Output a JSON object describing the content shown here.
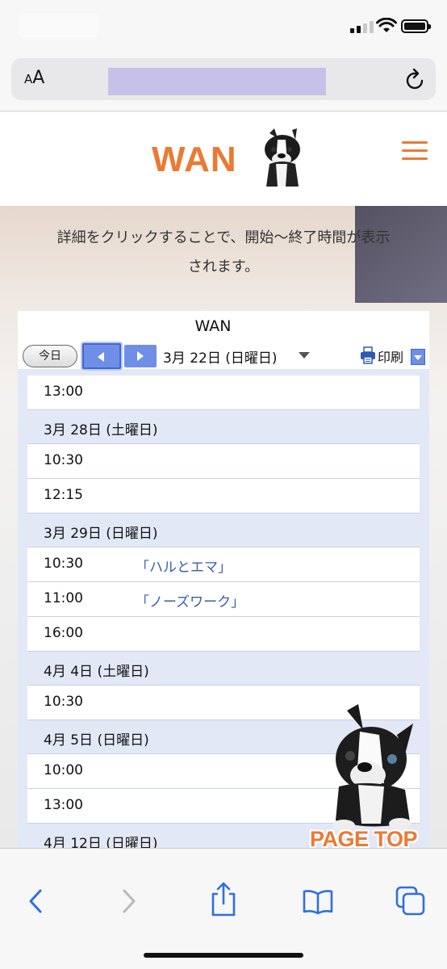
{
  "header": {
    "logo_text": "WAN"
  },
  "intro_text_1": "詳細をクリックすることで、開始〜終了時間が表示",
  "intro_text_2": "されます。",
  "calendar": {
    "title": "WAN",
    "today_label": "今日",
    "current_date": "3月 22日 (日曜日)",
    "print_label": "印刷",
    "entries": [
      {
        "type": "event",
        "time": "13:00",
        "title": ""
      },
      {
        "type": "day",
        "label": "3月 28日 (土曜日)"
      },
      {
        "type": "event",
        "time": "10:30",
        "title": ""
      },
      {
        "type": "event",
        "time": "12:15",
        "title": ""
      },
      {
        "type": "day",
        "label": "3月 29日 (日曜日)"
      },
      {
        "type": "event",
        "time": "10:30",
        "title": "「ハルとエマ」"
      },
      {
        "type": "event",
        "time": "11:00",
        "title": "「ノーズワーク」"
      },
      {
        "type": "event",
        "time": "16:00",
        "title": ""
      },
      {
        "type": "day",
        "label": "4月 4日 (土曜日)"
      },
      {
        "type": "event",
        "time": "10:30",
        "title": ""
      },
      {
        "type": "day",
        "label": "4月 5日 (日曜日)"
      },
      {
        "type": "event",
        "time": "10:00",
        "title": ""
      },
      {
        "type": "event",
        "time": "13:00",
        "title": ""
      },
      {
        "type": "day",
        "label": "4月 12日 (日曜日)"
      },
      {
        "type": "event",
        "time": "",
        "title": ""
      }
    ]
  },
  "page_top_label": "PAGE TOP",
  "browser": {
    "aa_label": "AA"
  },
  "colors": {
    "brand_orange": "#ea7a34",
    "calendar_blue": "#6f8fe6",
    "calendar_bg": "#e3e8f7",
    "event_link": "#3a5fa8"
  },
  "icons": [
    "signal-icon",
    "wifi-icon",
    "battery-icon",
    "reload-icon",
    "menu-icon",
    "print-icon",
    "back-icon",
    "forward-icon",
    "share-icon",
    "bookmarks-icon",
    "tabs-icon"
  ]
}
